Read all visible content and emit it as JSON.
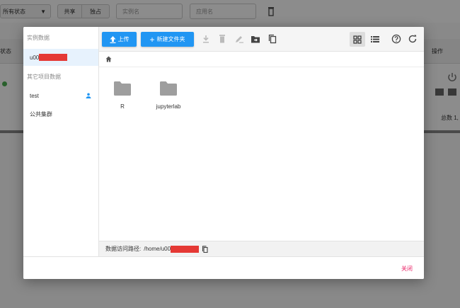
{
  "background": {
    "status_filter": "所有状态",
    "share_tab": "共享",
    "exclusive_tab": "独占",
    "instance_placeholder": "实例名",
    "app_placeholder": "应用名",
    "col_status": "状态",
    "col_ops": "操作",
    "total_label": "总数 1,"
  },
  "modal": {
    "instance_data_heading": "实例数据",
    "instance_user": "u00",
    "other_projects_heading": "其它项目数据",
    "projects": [
      {
        "label": "test"
      },
      {
        "label": "公共集群"
      }
    ],
    "upload_label": "上传",
    "new_folder_label": "新建文件夹",
    "folders": [
      {
        "name": "R"
      },
      {
        "name": "jupyterlab"
      }
    ],
    "path_label": "数据访问路径:",
    "path_value": "/home/u00",
    "close_label": "关闭"
  },
  "colors": {
    "primary": "#2196f3",
    "active_bg": "#e7f2fd",
    "close": "#e91e63",
    "redaction": "#e53935",
    "folder_icon": "#9e9e9e"
  }
}
